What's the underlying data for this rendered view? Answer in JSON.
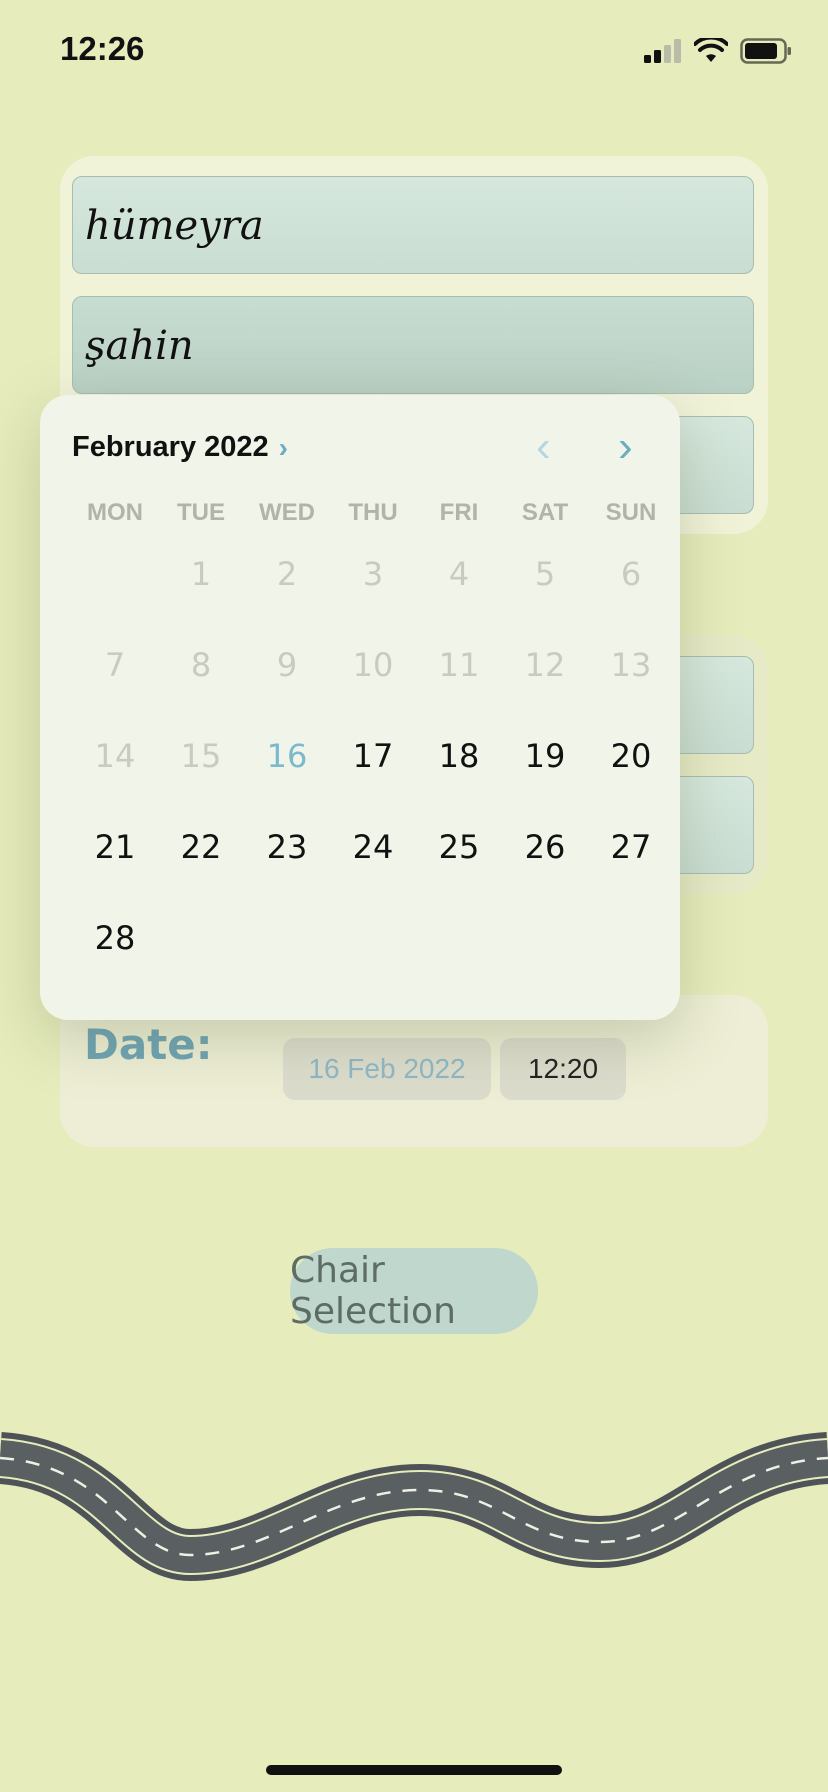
{
  "status": {
    "time": "12:26"
  },
  "form": {
    "first_name": "hümeyra",
    "last_name": "şahin",
    "date_label": "Date:",
    "date_value": "16 Feb 2022",
    "time_value": "12:20"
  },
  "chair_button": "Chair Selection",
  "calendar": {
    "month_label": "February 2022",
    "weekdays": [
      "MON",
      "TUE",
      "WED",
      "THU",
      "FRI",
      "SAT",
      "SUN"
    ],
    "selected_day": "16",
    "weeks": [
      [
        "",
        "1",
        "2",
        "3",
        "4",
        "5",
        "6"
      ],
      [
        "7",
        "8",
        "9",
        "10",
        "11",
        "12",
        "13"
      ],
      [
        "14",
        "15",
        "16",
        "17",
        "18",
        "19",
        "20"
      ],
      [
        "21",
        "22",
        "23",
        "24",
        "25",
        "26",
        "27"
      ],
      [
        "28"
      ]
    ],
    "disabled_days": [
      "1",
      "2",
      "3",
      "4",
      "5",
      "6",
      "7",
      "8",
      "9",
      "10",
      "11",
      "12",
      "13",
      "14",
      "15"
    ]
  },
  "colors": {
    "background": "#e6ecbc",
    "accent": "#6aaec3",
    "field": "#d6e8dd",
    "road": "#5a5f62"
  }
}
